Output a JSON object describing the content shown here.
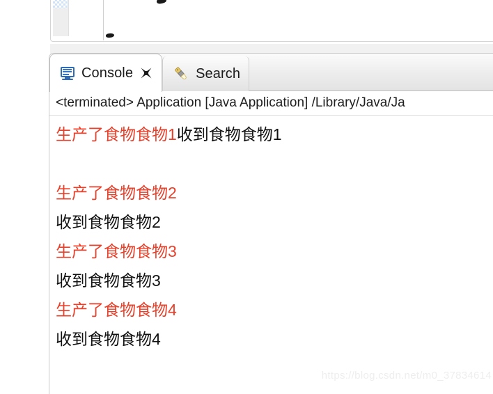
{
  "top_panel": {
    "scrollbar_name": "vertical-scrollbar",
    "thumb_color": "#cfe2f7"
  },
  "console_view": {
    "tabs": [
      {
        "id": "console",
        "label": "Console",
        "icon": "console-monitor-icon",
        "active": true,
        "closable": true,
        "close_icon": "close-icon"
      },
      {
        "id": "search",
        "label": "Search",
        "icon": "search-pencil-icon",
        "active": false,
        "closable": false
      }
    ],
    "terminated_line": "<terminated> Application [Java Application] /Library/Java/Ja",
    "output_lines": [
      {
        "segments": [
          {
            "text": "生产了食物食物1",
            "stream": "stderr"
          },
          {
            "text": "收到食物食物1",
            "stream": "stdout"
          }
        ]
      },
      {
        "segments": [
          {
            "text": "",
            "stream": "stdout"
          }
        ]
      },
      {
        "segments": [
          {
            "text": "生产了食物食物2",
            "stream": "stderr"
          }
        ]
      },
      {
        "segments": [
          {
            "text": "收到食物食物2",
            "stream": "stdout"
          }
        ]
      },
      {
        "segments": [
          {
            "text": "生产了食物食物3",
            "stream": "stderr"
          }
        ]
      },
      {
        "segments": [
          {
            "text": "收到食物食物3",
            "stream": "stdout"
          }
        ]
      },
      {
        "segments": [
          {
            "text": "生产了食物食物4",
            "stream": "stderr"
          }
        ]
      },
      {
        "segments": [
          {
            "text": "收到食物食物4",
            "stream": "stdout"
          }
        ]
      }
    ],
    "colors": {
      "stderr": "#E8402A",
      "stdout": "#111111",
      "tab_active_bg": "#ffffff",
      "tab_bar_bg": "#ececec"
    }
  },
  "watermark": {
    "text": "https://blog.csdn.net/m0_37834614"
  }
}
